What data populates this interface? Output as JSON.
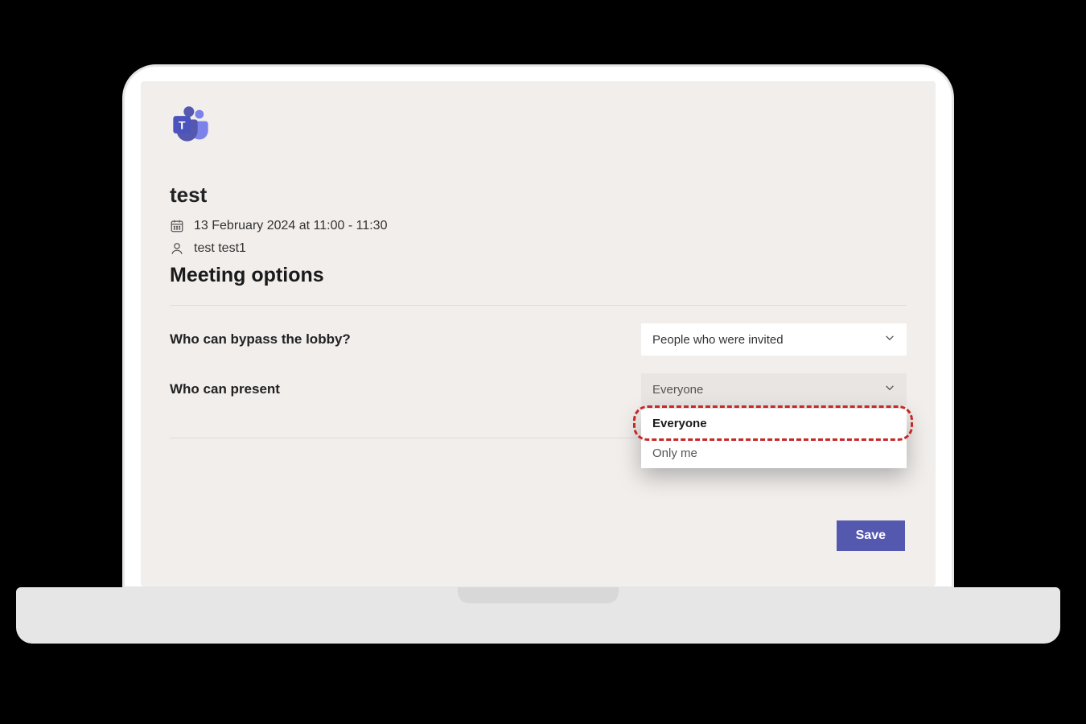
{
  "meeting": {
    "title": "test",
    "datetime": "13 February 2024 at 11:00 - 11:30",
    "organizer": "test test1"
  },
  "section_heading": "Meeting options",
  "options": {
    "bypass_lobby": {
      "label": "Who can bypass the lobby?",
      "value": "People who were invited"
    },
    "can_present": {
      "label": "Who can present",
      "value": "Everyone",
      "dropdown": {
        "option1": "Everyone",
        "option2": "Only me"
      }
    }
  },
  "buttons": {
    "save": "Save"
  },
  "colors": {
    "accent": "#5558af",
    "callout": "#c62828",
    "background": "#f1eeec"
  }
}
